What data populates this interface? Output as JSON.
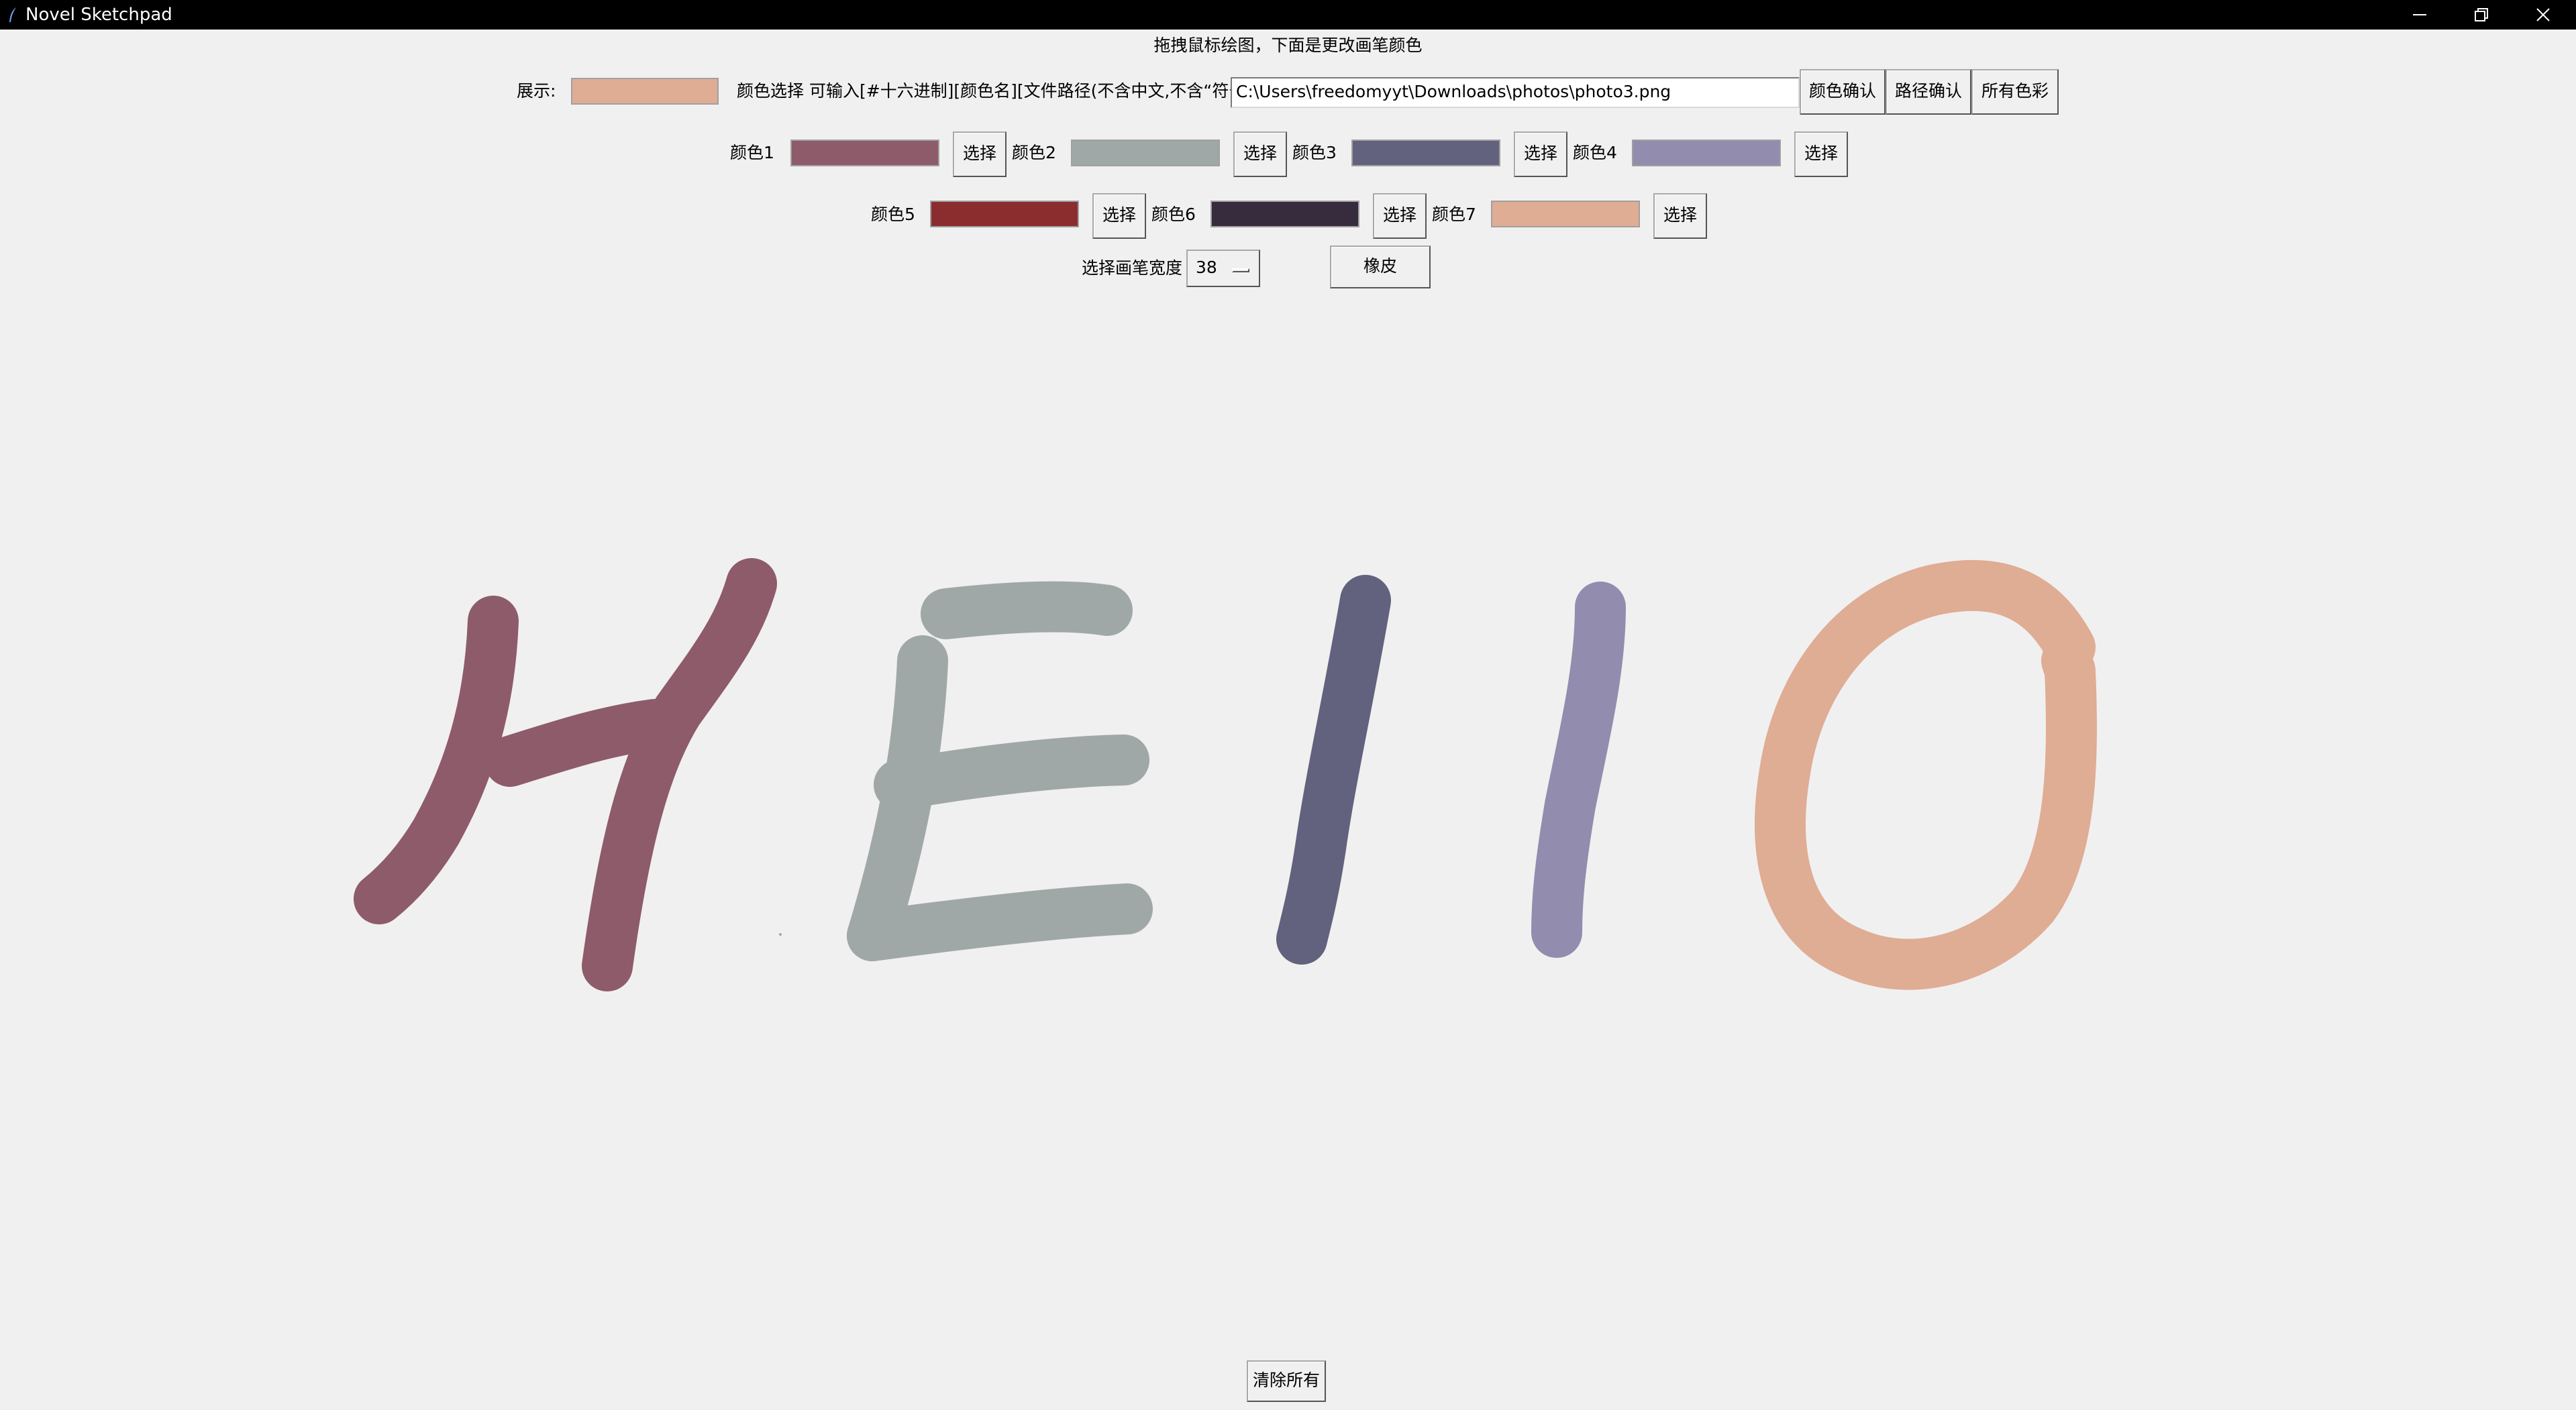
{
  "window": {
    "title": "Novel Sketchpad"
  },
  "hint": "拖拽鼠标绘图，下面是更改画笔颜色",
  "toolbar": {
    "preview_label": "展示:",
    "preview_color": "#dfac94",
    "color_select_label": "颜色选择 可输入[#十六进制][颜色名][文件路径(不含中文,不含“符号)]",
    "path_value": "C:\\Users\\freedomyyt\\Downloads\\photos\\photo3.png",
    "confirm_color_label": "颜色确认",
    "confirm_path_label": "路径确认",
    "all_colors_label": "所有色彩"
  },
  "palette": [
    {
      "label": "颜色1",
      "color": "#8e5b6a",
      "button": "选择"
    },
    {
      "label": "颜色2",
      "color": "#9fa8a6",
      "button": "选择"
    },
    {
      "label": "颜色3",
      "color": "#62627f",
      "button": "选择"
    },
    {
      "label": "颜色4",
      "color": "#928caf",
      "button": "选择"
    },
    {
      "label": "颜色5",
      "color": "#8b2c2f",
      "button": "选择"
    },
    {
      "label": "颜色6",
      "color": "#372b3e",
      "button": "选择"
    },
    {
      "label": "颜色7",
      "color": "#dfac94",
      "button": "选择"
    }
  ],
  "width_control": {
    "label": "选择画笔宽度",
    "value": "38"
  },
  "eraser_label": "橡皮",
  "clear_label": "清除所有",
  "drawing": {
    "text": "HEllO"
  }
}
